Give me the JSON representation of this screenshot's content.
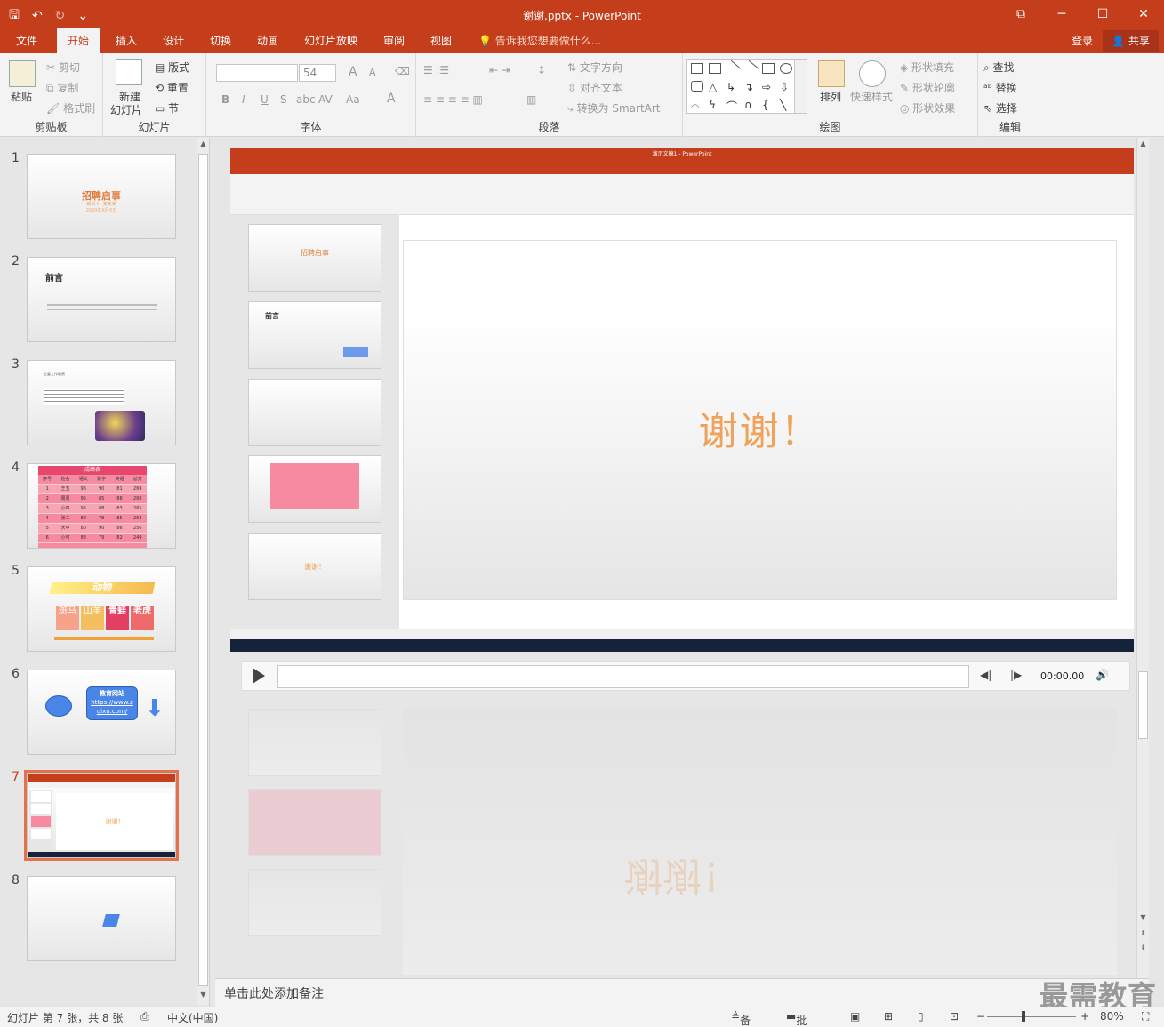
{
  "window": {
    "title": "谢谢.pptx - PowerPoint",
    "controls": [
      "⧉",
      "─",
      "☐",
      "✕"
    ]
  },
  "qat": {
    "save": "🖫",
    "undo": "↶",
    "redo": "↻",
    "more": "⌄"
  },
  "tabs": [
    {
      "label": "文件"
    },
    {
      "label": "开始"
    },
    {
      "label": "插入"
    },
    {
      "label": "设计"
    },
    {
      "label": "切换"
    },
    {
      "label": "动画"
    },
    {
      "label": "幻灯片放映"
    },
    {
      "label": "审阅"
    },
    {
      "label": "视图"
    }
  ],
  "active_tab": "开始",
  "tellme": "告诉我您想要做什么...",
  "account": {
    "login": "登录",
    "share": "共享"
  },
  "ribbon": {
    "clipboard": {
      "label": "剪贴板",
      "paste": "粘贴",
      "cut": "剪切",
      "copy": "复制",
      "format_painter": "格式刷"
    },
    "slides": {
      "label": "幻灯片",
      "new_slide": "新建",
      "new_slide2": "幻灯片",
      "layout": "版式",
      "reset": "重置",
      "section": "节"
    },
    "font": {
      "label": "字体",
      "font_size": "54",
      "bold": "B",
      "italic": "I",
      "underline": "U",
      "shadow": "S",
      "strike": "abc",
      "spacing": "AV",
      "case": "Aa",
      "color": "A",
      "grow": "A",
      "shrink": "A"
    },
    "paragraph": {
      "label": "段落",
      "text_direction": "文字方向",
      "align_text": "对齐文本",
      "smartart": "转换为 SmartArt"
    },
    "drawing": {
      "label": "绘图",
      "arrange": "排列",
      "quick_styles": "快速样式",
      "shape_fill": "形状填充",
      "shape_outline": "形状轮廓",
      "shape_effects": "形状效果"
    },
    "editing": {
      "label": "编辑",
      "find": "查找",
      "replace": "替换",
      "select": "选择"
    }
  },
  "thumbnails": [
    {
      "num": "1",
      "title": "招聘启事",
      "sub": "编辑人: 某某某",
      "date": "2020年X月X日"
    },
    {
      "num": "2",
      "title": "前言"
    },
    {
      "num": "3",
      "title": "主要工作职责"
    },
    {
      "num": "4",
      "title": "成绩表",
      "headers": [
        "序号",
        "姓名",
        "语文",
        "数学",
        "英语",
        "总分"
      ],
      "rows": [
        [
          "1",
          "王五",
          "96",
          "90",
          "81",
          "269"
        ],
        [
          "2",
          "周周",
          "95",
          "85",
          "88",
          "268"
        ],
        [
          "3",
          "小四",
          "96",
          "88",
          "83",
          "265"
        ],
        [
          "4",
          "张三",
          "89",
          "78",
          "85",
          "252"
        ],
        [
          "5",
          "大中",
          "80",
          "90",
          "86",
          "256"
        ],
        [
          "6",
          "小可",
          "88",
          "79",
          "82",
          "249"
        ]
      ]
    },
    {
      "num": "5",
      "title": "动物",
      "cells": [
        "斑马",
        "山羊",
        "青蛙",
        "老虎"
      ]
    },
    {
      "num": "6",
      "box_title": "教育网站",
      "link": "https://www.zuixu.com/"
    },
    {
      "num": "7",
      "title": "谢谢！"
    },
    {
      "num": "8"
    }
  ],
  "video": {
    "title": "演示文稿1 - PowerPoint",
    "slide_text": "谢谢！",
    "thumb_title": "招聘启事",
    "thumb_title2": "前言",
    "thumb_text5": "谢谢！"
  },
  "player": {
    "time": "00:00.00"
  },
  "notes_placeholder": "单击此处添加备注",
  "watermark": "最需教育",
  "status": {
    "slide_info": "幻灯片 第 7 张，共 8 张",
    "language": "中文(中国)",
    "notes": "备注",
    "comments": "批注",
    "zoom": "80%"
  },
  "colors": {
    "accent": "#c43e1c",
    "thanks": "#f0a25a"
  }
}
